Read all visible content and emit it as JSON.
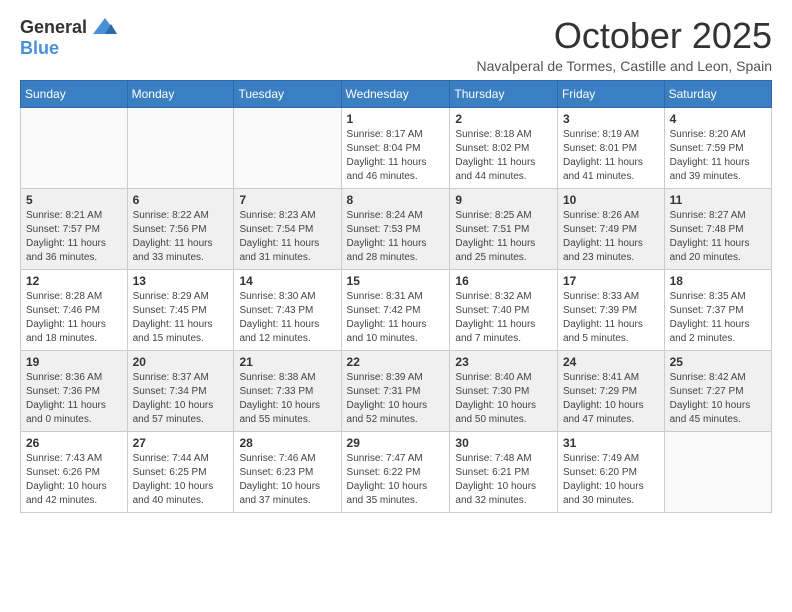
{
  "logo": {
    "general": "General",
    "blue": "Blue"
  },
  "header": {
    "month": "October 2025",
    "location": "Navalperal de Tormes, Castille and Leon, Spain"
  },
  "days_of_week": [
    "Sunday",
    "Monday",
    "Tuesday",
    "Wednesday",
    "Thursday",
    "Friday",
    "Saturday"
  ],
  "weeks": [
    {
      "shaded": false,
      "days": [
        {
          "num": "",
          "info": ""
        },
        {
          "num": "",
          "info": ""
        },
        {
          "num": "",
          "info": ""
        },
        {
          "num": "1",
          "info": "Sunrise: 8:17 AM\nSunset: 8:04 PM\nDaylight: 11 hours and 46 minutes."
        },
        {
          "num": "2",
          "info": "Sunrise: 8:18 AM\nSunset: 8:02 PM\nDaylight: 11 hours and 44 minutes."
        },
        {
          "num": "3",
          "info": "Sunrise: 8:19 AM\nSunset: 8:01 PM\nDaylight: 11 hours and 41 minutes."
        },
        {
          "num": "4",
          "info": "Sunrise: 8:20 AM\nSunset: 7:59 PM\nDaylight: 11 hours and 39 minutes."
        }
      ]
    },
    {
      "shaded": true,
      "days": [
        {
          "num": "5",
          "info": "Sunrise: 8:21 AM\nSunset: 7:57 PM\nDaylight: 11 hours and 36 minutes."
        },
        {
          "num": "6",
          "info": "Sunrise: 8:22 AM\nSunset: 7:56 PM\nDaylight: 11 hours and 33 minutes."
        },
        {
          "num": "7",
          "info": "Sunrise: 8:23 AM\nSunset: 7:54 PM\nDaylight: 11 hours and 31 minutes."
        },
        {
          "num": "8",
          "info": "Sunrise: 8:24 AM\nSunset: 7:53 PM\nDaylight: 11 hours and 28 minutes."
        },
        {
          "num": "9",
          "info": "Sunrise: 8:25 AM\nSunset: 7:51 PM\nDaylight: 11 hours and 25 minutes."
        },
        {
          "num": "10",
          "info": "Sunrise: 8:26 AM\nSunset: 7:49 PM\nDaylight: 11 hours and 23 minutes."
        },
        {
          "num": "11",
          "info": "Sunrise: 8:27 AM\nSunset: 7:48 PM\nDaylight: 11 hours and 20 minutes."
        }
      ]
    },
    {
      "shaded": false,
      "days": [
        {
          "num": "12",
          "info": "Sunrise: 8:28 AM\nSunset: 7:46 PM\nDaylight: 11 hours and 18 minutes."
        },
        {
          "num": "13",
          "info": "Sunrise: 8:29 AM\nSunset: 7:45 PM\nDaylight: 11 hours and 15 minutes."
        },
        {
          "num": "14",
          "info": "Sunrise: 8:30 AM\nSunset: 7:43 PM\nDaylight: 11 hours and 12 minutes."
        },
        {
          "num": "15",
          "info": "Sunrise: 8:31 AM\nSunset: 7:42 PM\nDaylight: 11 hours and 10 minutes."
        },
        {
          "num": "16",
          "info": "Sunrise: 8:32 AM\nSunset: 7:40 PM\nDaylight: 11 hours and 7 minutes."
        },
        {
          "num": "17",
          "info": "Sunrise: 8:33 AM\nSunset: 7:39 PM\nDaylight: 11 hours and 5 minutes."
        },
        {
          "num": "18",
          "info": "Sunrise: 8:35 AM\nSunset: 7:37 PM\nDaylight: 11 hours and 2 minutes."
        }
      ]
    },
    {
      "shaded": true,
      "days": [
        {
          "num": "19",
          "info": "Sunrise: 8:36 AM\nSunset: 7:36 PM\nDaylight: 11 hours and 0 minutes."
        },
        {
          "num": "20",
          "info": "Sunrise: 8:37 AM\nSunset: 7:34 PM\nDaylight: 10 hours and 57 minutes."
        },
        {
          "num": "21",
          "info": "Sunrise: 8:38 AM\nSunset: 7:33 PM\nDaylight: 10 hours and 55 minutes."
        },
        {
          "num": "22",
          "info": "Sunrise: 8:39 AM\nSunset: 7:31 PM\nDaylight: 10 hours and 52 minutes."
        },
        {
          "num": "23",
          "info": "Sunrise: 8:40 AM\nSunset: 7:30 PM\nDaylight: 10 hours and 50 minutes."
        },
        {
          "num": "24",
          "info": "Sunrise: 8:41 AM\nSunset: 7:29 PM\nDaylight: 10 hours and 47 minutes."
        },
        {
          "num": "25",
          "info": "Sunrise: 8:42 AM\nSunset: 7:27 PM\nDaylight: 10 hours and 45 minutes."
        }
      ]
    },
    {
      "shaded": false,
      "days": [
        {
          "num": "26",
          "info": "Sunrise: 7:43 AM\nSunset: 6:26 PM\nDaylight: 10 hours and 42 minutes."
        },
        {
          "num": "27",
          "info": "Sunrise: 7:44 AM\nSunset: 6:25 PM\nDaylight: 10 hours and 40 minutes."
        },
        {
          "num": "28",
          "info": "Sunrise: 7:46 AM\nSunset: 6:23 PM\nDaylight: 10 hours and 37 minutes."
        },
        {
          "num": "29",
          "info": "Sunrise: 7:47 AM\nSunset: 6:22 PM\nDaylight: 10 hours and 35 minutes."
        },
        {
          "num": "30",
          "info": "Sunrise: 7:48 AM\nSunset: 6:21 PM\nDaylight: 10 hours and 32 minutes."
        },
        {
          "num": "31",
          "info": "Sunrise: 7:49 AM\nSunset: 6:20 PM\nDaylight: 10 hours and 30 minutes."
        },
        {
          "num": "",
          "info": ""
        }
      ]
    }
  ]
}
